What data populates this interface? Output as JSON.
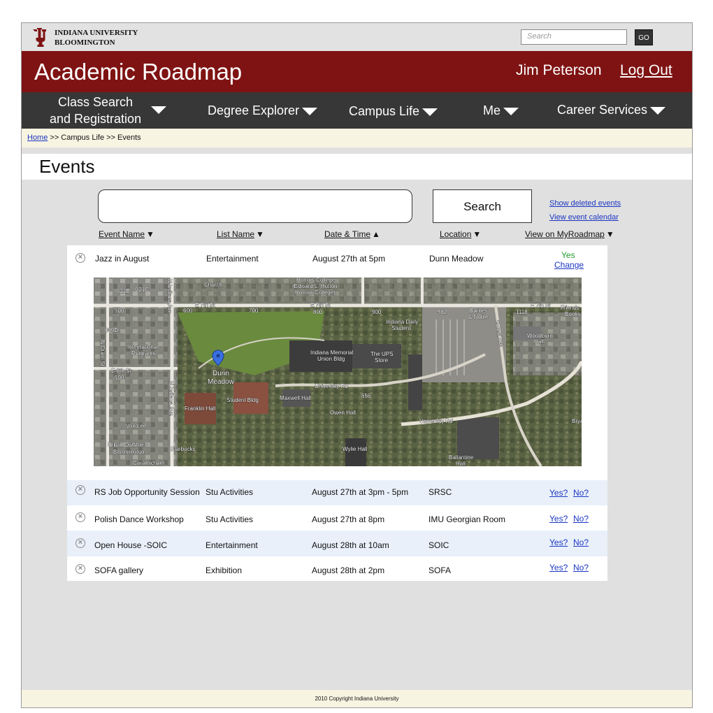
{
  "topbar": {
    "university_line1": "INDIANA UNIVERSITY",
    "university_line2": "BLOOMINGTON",
    "search_placeholder": "Search",
    "go_label": "GO"
  },
  "header": {
    "app_title": "Academic Roadmap",
    "user_name": "Jim Peterson",
    "logout_label": "Log Out"
  },
  "nav": {
    "items": [
      {
        "line1": "Class Search",
        "line2": "and Registration"
      },
      {
        "line1": "Degree Explorer"
      },
      {
        "line1": "Campus Life"
      },
      {
        "line1": "Me"
      },
      {
        "line1": "Career Services"
      }
    ]
  },
  "breadcrumb": {
    "home": "Home",
    "rest": " >> Campus Life >> Events"
  },
  "page": {
    "title": "Events",
    "search_button": "Search",
    "show_deleted": "Show deleted events",
    "view_calendar": "View event calendar"
  },
  "columns": {
    "event_name": "Event Name",
    "list_name": "List Name",
    "date_time": "Date & Time",
    "location": "Location",
    "view_on": "View on MyRoadmap",
    "arrow_down": "▼",
    "arrow_up": "▲"
  },
  "map_labels": {
    "street_e7th": "E 7th St",
    "street_university": "University Rd",
    "street_dunn": "N Dunn St",
    "street_indiana": "N Indiana Ave",
    "street_forest": "Forest Ave",
    "place_dunn_meadow_1": "Dunn",
    "place_dunn_meadow_2": "Meadow",
    "place_imu_1": "Indiana Memorial",
    "place_imu_2": "Union Bldg",
    "place_ups_1": "The UPS",
    "place_ups_2": "Store",
    "place_student_bldg": "Student Bldg",
    "place_franklin": "Franklin Hall",
    "place_maxwell": "Maxwell Hall",
    "place_owen": "Owen Hall",
    "place_wylie": "Wylie Hall",
    "place_woodburn_1": "Woodburn",
    "place_woodburn_2": "Hall",
    "place_barnes_1": "Barnes",
    "place_barnes_2": "& Noble",
    "place_international_1": "International",
    "place_international_2": "Programs",
    "place_church": "Church",
    "place_honors_1": "Honors College",
    "place_honors_2": "(Edward L. Hutton",
    "place_honors_3": "Honors College)",
    "place_ids_1": "Indiana Daily",
    "place_ids_2": "Student",
    "place_starbucks": "Starbucks",
    "place_urban_1": "Urban Outfitters",
    "place_urban_2": "Bloomington",
    "place_caramichael": "Caramichael",
    "place_von_lee": "Von Lee",
    "place_ballantine_1": "Ballantine",
    "place_ballantine_2": "Hall",
    "place_friends_1": "Friends",
    "place_friends_2": "Books",
    "street_e6th": "E 6th St",
    "num_021b": "021B",
    "num_021c": "021C",
    "num_500": "500",
    "num_600": "600",
    "num_700": "700",
    "num_800": "800",
    "num_900": "900",
    "num_982": "982",
    "num_1118": "1118",
    "num_009d": "009D",
    "num_656": "656",
    "num_500b": "500",
    "brya": "Brya"
  },
  "events": [
    {
      "name": "Jazz in August",
      "list": "Entertainment",
      "datetime": "August 27th at 5pm",
      "location": "Dunn Meadow",
      "status": "Yes",
      "change": "Change"
    },
    {
      "name": "RS Job Opportunity Session",
      "list": "Stu Activities",
      "datetime": "August 27th at 3pm - 5pm",
      "location": "SRSC",
      "yes": "Yes?",
      "no": "No?"
    },
    {
      "name": "Polish Dance Workshop",
      "list": "Stu Activities",
      "datetime": "August 27th at 8pm",
      "location": "IMU Georgian Room",
      "yes": "Yes?",
      "no": "No?"
    },
    {
      "name": "Open House -SOIC",
      "list": "Entertainment",
      "datetime": "August 28th at 10am",
      "location": "SOIC",
      "yes": "Yes?",
      "no": "No?"
    },
    {
      "name": "SOFA gallery",
      "list": "Exhibition",
      "datetime": "August 28th at 2pm",
      "location": "SOFA",
      "yes": "Yes?",
      "no": "No?"
    }
  ],
  "footer": {
    "copyright": "2010 Copyright Indiana University"
  },
  "colors": {
    "crimson": "#7f1313",
    "nav": "#373737",
    "link": "#1b36c2",
    "yes_green": "#1f9a2a"
  }
}
